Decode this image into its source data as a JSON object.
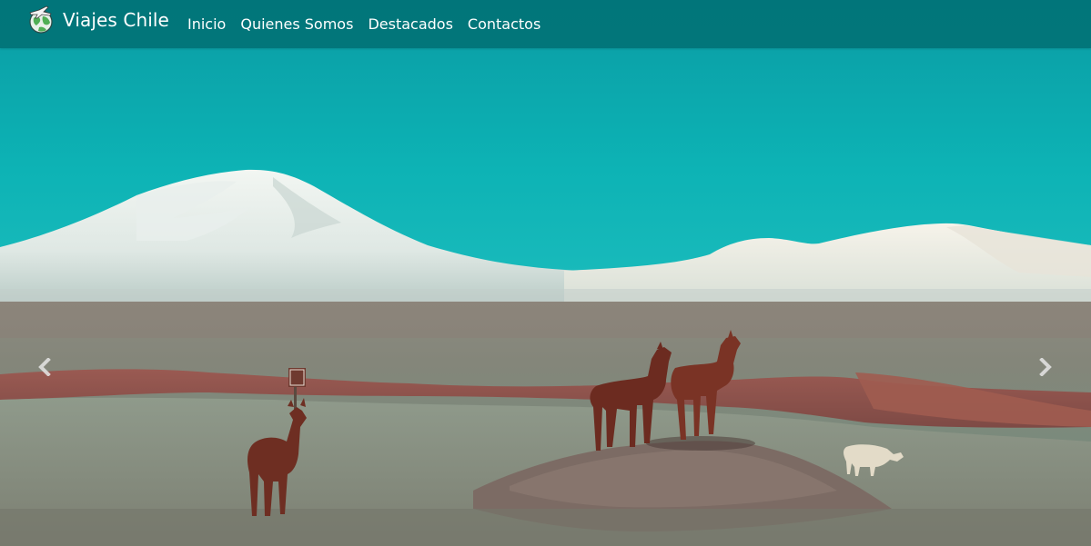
{
  "navbar": {
    "brand": {
      "name": "Viajes Chile",
      "logo_icon": "globe-plane-icon"
    },
    "links": [
      {
        "label": "Inicio"
      },
      {
        "label": "Quienes Somos"
      },
      {
        "label": "Destacados"
      },
      {
        "label": "Contactos"
      }
    ]
  },
  "carousel": {
    "image_description": "Llamas in the Atacama altiplano with snow-capped volcanoes",
    "prev_icon": "chevron-left-icon",
    "next_icon": "chevron-right-icon"
  },
  "colors": {
    "navbar_bg": "#006c70",
    "sky": "#0aa7ad",
    "brand_text": "#ffffff"
  }
}
